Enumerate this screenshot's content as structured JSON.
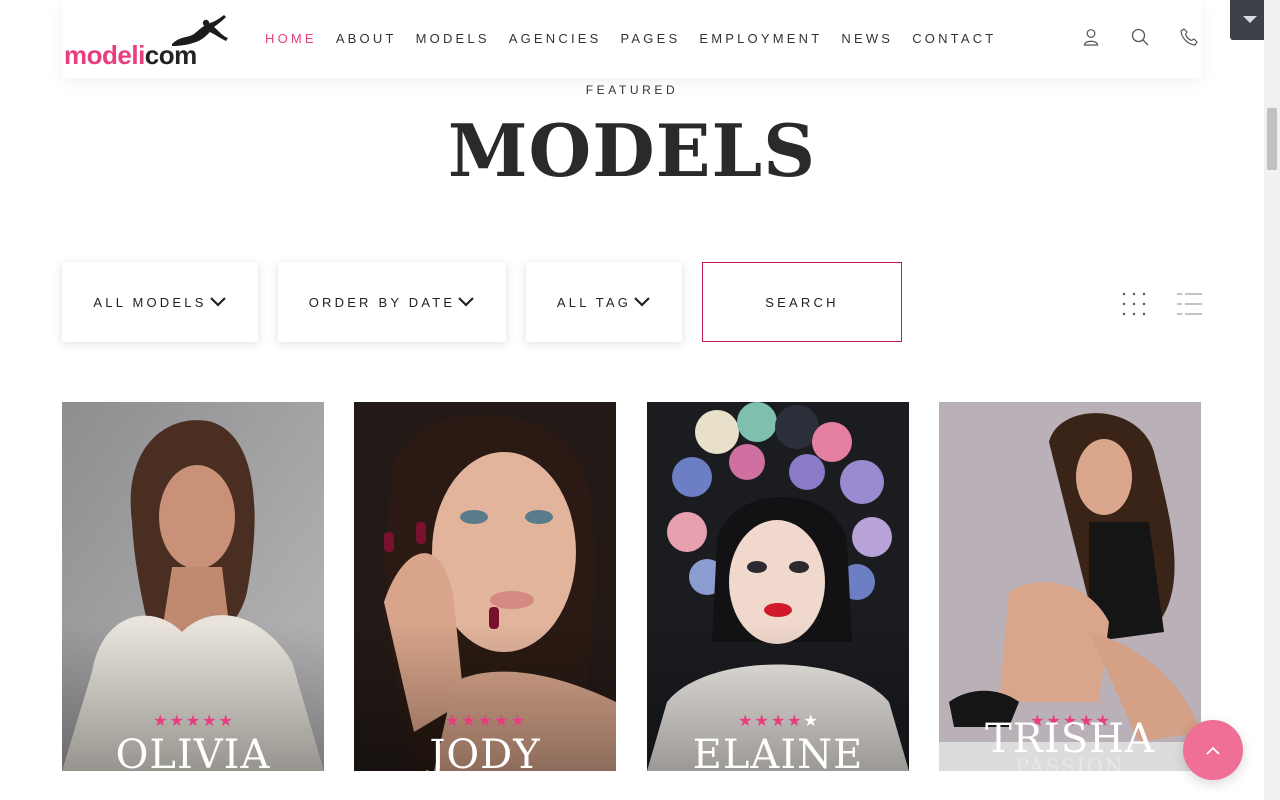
{
  "logo": {
    "part1": "modeli",
    "part2": "com"
  },
  "nav": {
    "items": [
      {
        "label": "HOME",
        "active": true
      },
      {
        "label": "ABOUT"
      },
      {
        "label": "MODELS"
      },
      {
        "label": "AGENCIES"
      },
      {
        "label": "PAGES"
      },
      {
        "label": "EMPLOYMENT"
      },
      {
        "label": "NEWS"
      },
      {
        "label": "CONTACT"
      }
    ]
  },
  "hero": {
    "eyebrow": "FEATURED",
    "title": "MODELS"
  },
  "filters": {
    "models": "ALL MODELS",
    "order": "ORDER BY DATE",
    "tag": "ALL TAG",
    "search": "SEARCH"
  },
  "cards": [
    {
      "name": "OLIVIA",
      "rating": 5,
      "sub": ""
    },
    {
      "name": "JODY",
      "rating": 5,
      "sub": ""
    },
    {
      "name": "ELAINE",
      "rating": 4,
      "sub": ""
    },
    {
      "name": "TRISHA",
      "rating": 5,
      "sub": "PASSION"
    }
  ],
  "colors": {
    "accent": "#e63e80",
    "button_border": "#c2185b",
    "to_top": "#ef6f96"
  },
  "icons": [
    "user-icon",
    "search-icon",
    "phone-icon",
    "grid-view-icon",
    "list-view-icon",
    "chevron-down-icon",
    "arrow-up-icon"
  ]
}
